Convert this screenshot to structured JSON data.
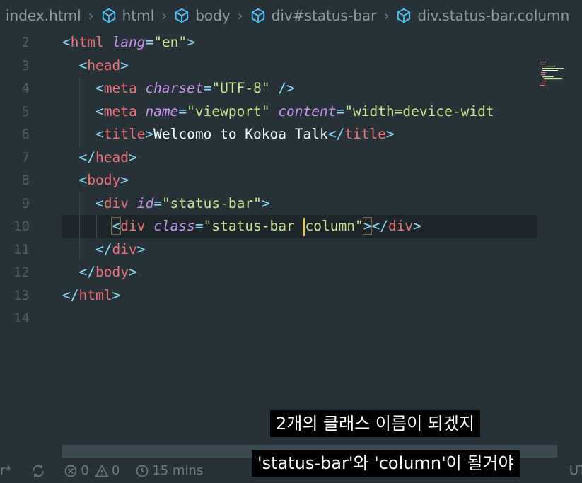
{
  "breadcrumb": {
    "items": [
      "index.html",
      "html",
      "body",
      "div#status-bar",
      "div.status-bar.column"
    ]
  },
  "editor": {
    "line_numbers": [
      "2",
      "3",
      "4",
      "5",
      "6",
      "7",
      "8",
      "9",
      "10",
      "11",
      "12",
      "13",
      "14"
    ],
    "current_line": "10",
    "code": {
      "l2": {
        "tag": "html",
        "attr": "lang",
        "value": "\"en\""
      },
      "l3": {
        "tag": "head"
      },
      "l4": {
        "tag": "meta",
        "attr": "charset",
        "value": "\"UTF-8\"",
        "close": " />"
      },
      "l5": {
        "tag": "meta",
        "attr1": "name",
        "value1": "\"viewport\"",
        "attr2": "content",
        "value2": "\"width=device-widt"
      },
      "l6": {
        "tag": "title",
        "text": "Welcomo to Kokoa Talk",
        "close_tag": "title"
      },
      "l7": {
        "close_tag": "head"
      },
      "l8": {
        "tag": "body"
      },
      "l9": {
        "tag": "div",
        "attr": "id",
        "value": "\"status-bar\""
      },
      "l10": {
        "tag": "div",
        "attr": "class",
        "value_before": "\"status-bar ",
        "value_after": "column\"",
        "close_tag": "div"
      },
      "l11": {
        "close_tag": "div"
      },
      "l12": {
        "close_tag": "body"
      },
      "l13": {
        "close_tag": "html"
      }
    }
  },
  "statusbar": {
    "left_fragment": "r*",
    "errors": "0",
    "warnings": "0",
    "time": "15 mins",
    "right_fragment": "UT"
  },
  "subtitles": {
    "line1": "2개의 클래스 이름이 되겠지",
    "line2": "'status-bar'와 'column'이 될거야"
  },
  "colors": {
    "background": "#263238",
    "tag": "#f07178",
    "punctuation": "#89ddff",
    "attribute": "#c792ea",
    "string": "#c3e88d",
    "cursor": "#ffcc00"
  }
}
